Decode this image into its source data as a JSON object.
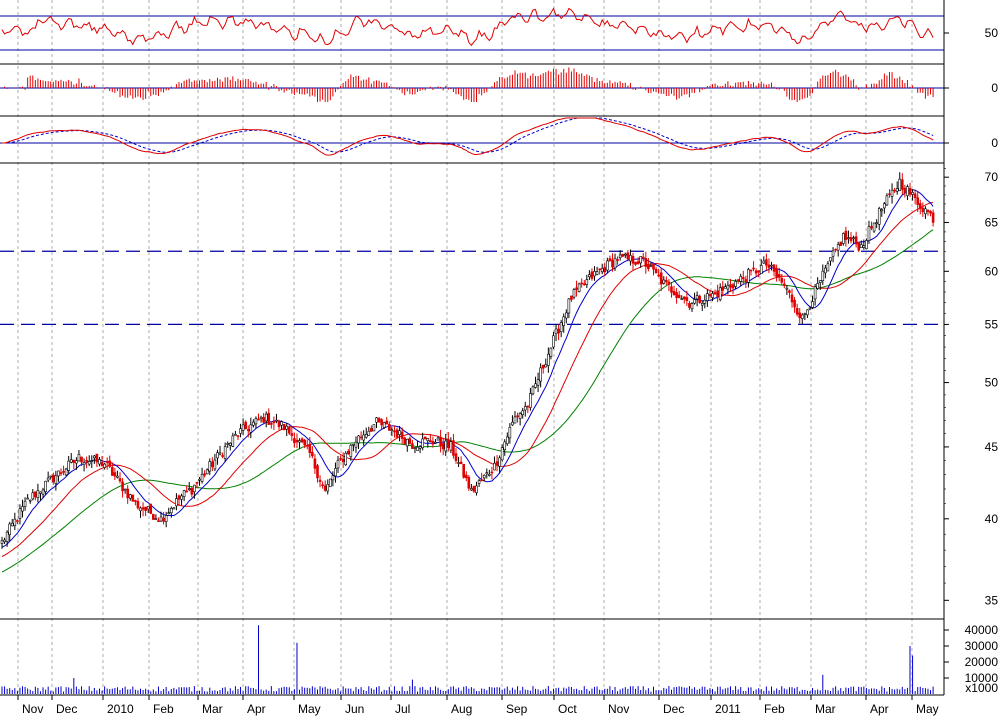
{
  "chart_data": {
    "type": "candlestick",
    "price_axis": {
      "scale": "log",
      "ticks": [
        35,
        40,
        45,
        50,
        55,
        60,
        65,
        70
      ],
      "ylim": [
        34,
        72
      ]
    },
    "resistance_lines": [
      62,
      55
    ],
    "months": [
      "Nov",
      "Dec",
      "2010",
      "Feb",
      "Mar",
      "Apr",
      "May",
      "Jun",
      "Jul",
      "Aug",
      "Sep",
      "Oct",
      "Nov",
      "Dec",
      "2011",
      "Feb",
      "Mar",
      "Apr",
      "May"
    ],
    "close_by_month": [
      40.5,
      43.0,
      41.0,
      40.0,
      44.0,
      47.0,
      42.5,
      46.0,
      45.5,
      43.5,
      41.5,
      52.0,
      57.5,
      61.5,
      58.0,
      60.0,
      58.0,
      63.5,
      66.0
    ],
    "price_anchors": {
      "t": [
        0,
        10,
        20,
        30,
        40,
        52,
        62,
        70,
        74,
        82,
        86,
        92,
        102,
        110,
        120,
        126,
        131,
        138,
        146,
        152,
        160,
        167,
        175,
        183,
        192,
        200,
        205,
        214,
        222,
        230,
        240,
        250,
        258,
        268,
        278,
        288,
        298,
        305,
        312,
        320,
        328,
        335,
        342,
        350,
        356,
        363
      ],
      "close": [
        38.5,
        41.2,
        42.8,
        44.2,
        43.8,
        41.0,
        40.0,
        41.5,
        42.0,
        43.8,
        44.7,
        46.0,
        47.2,
        46.5,
        44.5,
        41.8,
        43.7,
        45.5,
        46.8,
        46.3,
        45.2,
        45.5,
        45.0,
        41.8,
        43.6,
        47.2,
        48.2,
        53.0,
        57.5,
        59.5,
        61.3,
        61.0,
        58.8,
        57.0,
        57.8,
        59.2,
        60.7,
        58.6,
        55.5,
        59.5,
        63.5,
        62.5,
        66.0,
        69.5,
        67.5,
        65.5
      ]
    },
    "oscillators": [
      {
        "type": "line",
        "level_labels": [
          "50"
        ],
        "levels": [
          0.18,
          0.82
        ]
      },
      {
        "type": "histogram",
        "level_labels": [
          "0"
        ]
      },
      {
        "type": "line",
        "level_labels": [
          "0"
        ]
      }
    ],
    "volume_axis": {
      "unit": "x1000",
      "ticks": [
        10000,
        20000,
        30000,
        40000
      ],
      "max": 45000,
      "spikes": [
        [
          100,
          43000
        ],
        [
          115,
          32000
        ],
        [
          354,
          30000
        ],
        [
          355,
          24000
        ],
        [
          320,
          12000
        ],
        [
          28,
          10000
        ],
        [
          160,
          9000
        ]
      ]
    },
    "colors": {
      "up": "#000000",
      "down": "#e00000",
      "ma_short": "#0000cc",
      "ma_mid": "#e00000",
      "ma_long": "#008000",
      "hline": "#0000a0",
      "grid": "#999999",
      "volume": "#0000cc"
    }
  }
}
